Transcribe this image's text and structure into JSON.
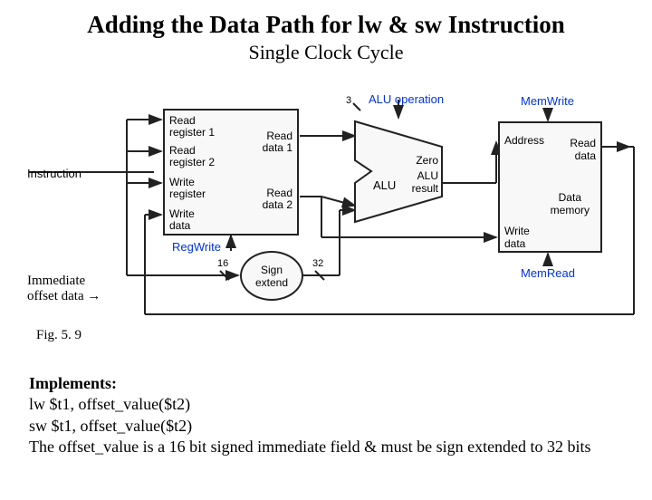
{
  "title": "Adding the Data Path for lw & sw Instruction",
  "subtitle": "Single Clock Cycle",
  "instruction_label": "Instruction",
  "regfile": {
    "in1": "Read\nregister 1",
    "in2": "Read\nregister 2",
    "in3": "Write\nregister",
    "in4": "Write\ndata",
    "out1": "Read\ndata 1",
    "out2": "Read\ndata 2"
  },
  "alu": {
    "label": "ALU",
    "zero": "Zero",
    "result": "ALU\nresult",
    "op_bits": "3",
    "op_label": "ALU operation"
  },
  "mem": {
    "address": "Address",
    "write_data": "Write\ndata",
    "read_data": "Read\ndata",
    "name": "Data\nmemory"
  },
  "signext": {
    "label": "Sign\nextend",
    "in_bits": "16",
    "out_bits": "32"
  },
  "controls": {
    "regwrite": "RegWrite",
    "memwrite": "MemWrite",
    "memread": "MemRead"
  },
  "annot": {
    "immediate": "Immediate\noffset data →",
    "figure": "Fig. 5. 9"
  },
  "description": {
    "head": "Implements:",
    "l1": "lw $t1, offset_value($t2)",
    "l2": "sw $t1, offset_value($t2)",
    "l3": "The offset_value is a 16 bit signed immediate field & must be sign extended to 32 bits"
  }
}
